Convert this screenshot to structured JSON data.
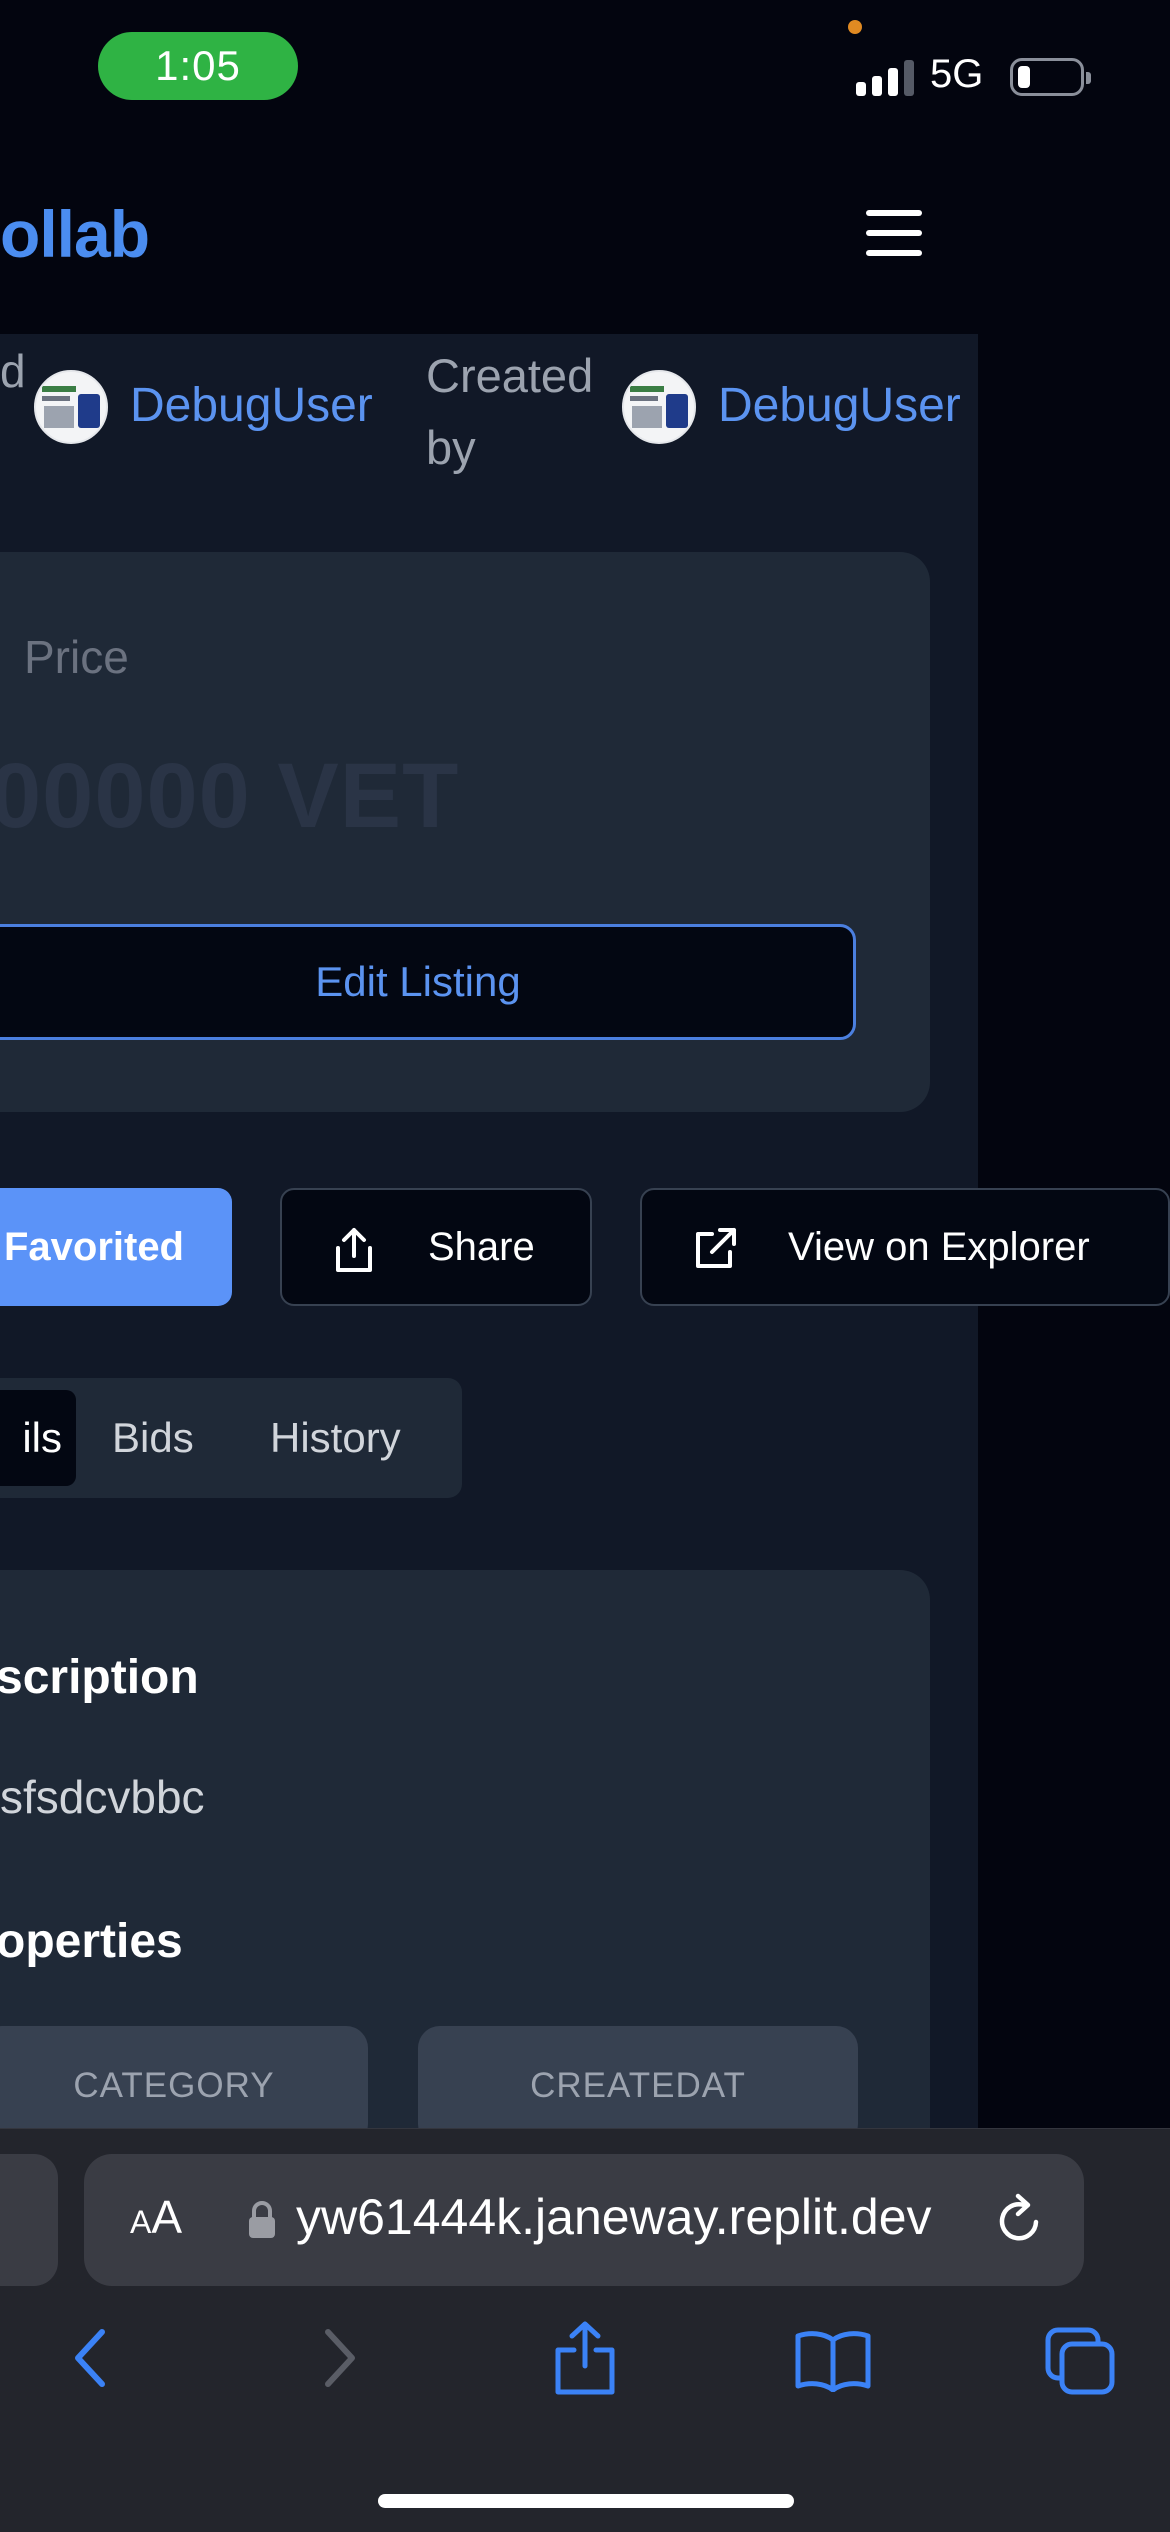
{
  "status_bar": {
    "time": "1:05",
    "network": "5G"
  },
  "app_header": {
    "logo_text": "ollab"
  },
  "creators": {
    "left_fragment": "d",
    "owner_name": "DebugUser",
    "created_by_label": "Created by",
    "creator_name": "DebugUser"
  },
  "price_card": {
    "label": "Price",
    "value": "00000 VET",
    "edit_button": "Edit Listing"
  },
  "actions": {
    "favorited": "Favorited",
    "share": "Share",
    "explorer": "View on Explorer"
  },
  "tabs": [
    {
      "label": "ils",
      "active": true
    },
    {
      "label": "Bids",
      "active": false
    },
    {
      "label": "History",
      "active": false
    }
  ],
  "details": {
    "description_title": "scription",
    "description_text": "sfsdcvbbc",
    "properties_title": "operties",
    "properties": [
      {
        "label": "CATEGORY"
      },
      {
        "label": "CREATEDAT"
      }
    ]
  },
  "browser": {
    "text_size_label_small": "A",
    "text_size_label_large": "A",
    "url": "yw61444k.janeway.replit.dev"
  },
  "colors": {
    "accent": "#5b93f0",
    "background": "#03050f",
    "surface": "#111827",
    "card": "#1f2937"
  }
}
